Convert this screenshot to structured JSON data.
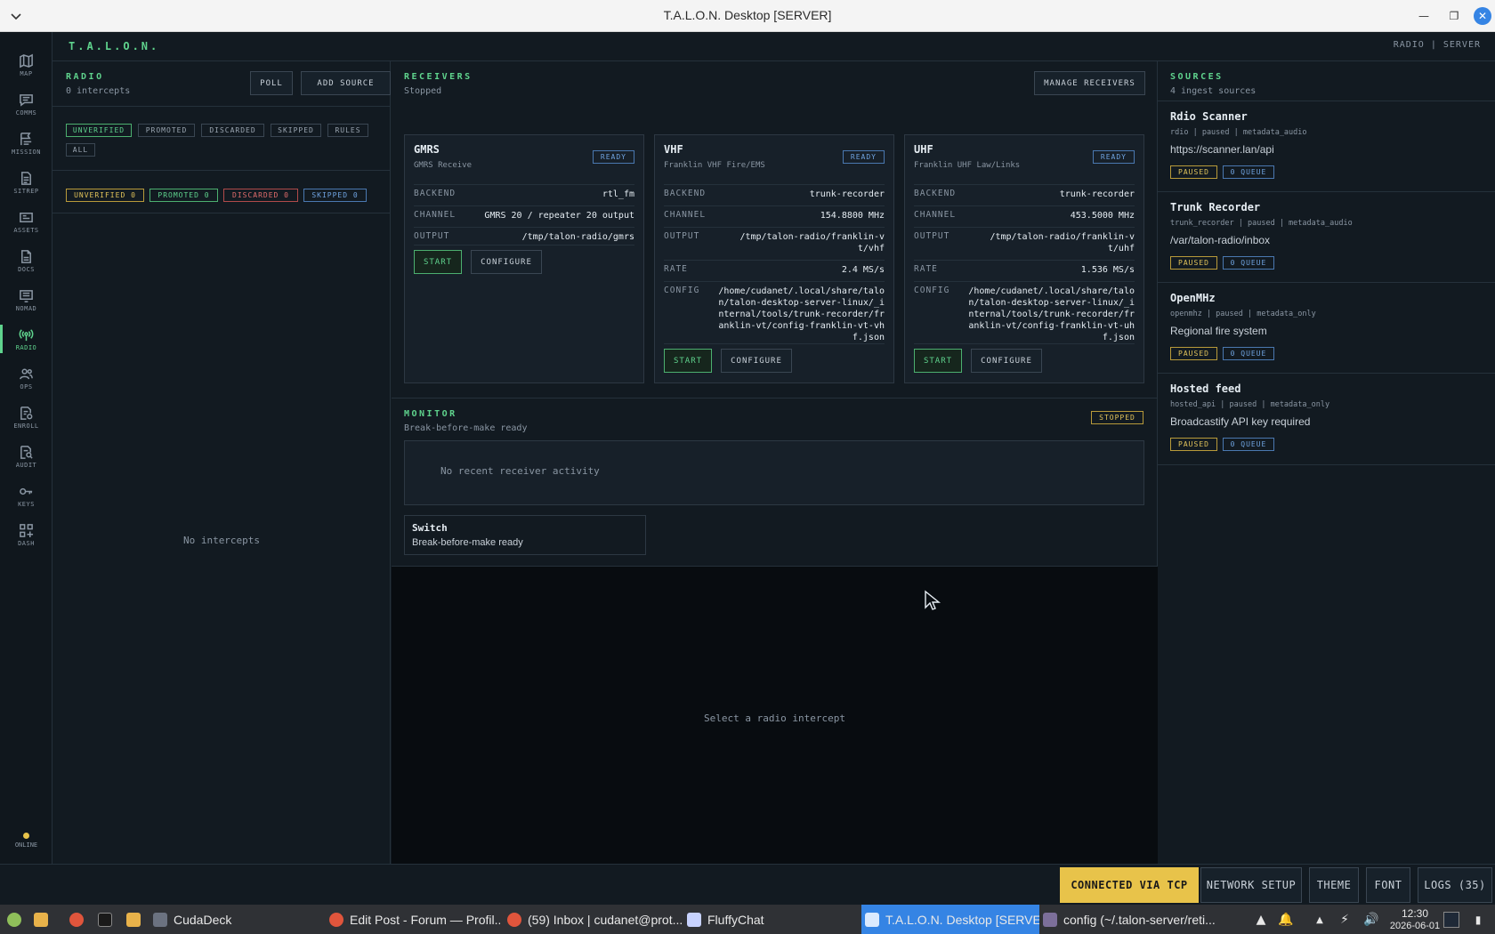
{
  "window": {
    "title": "T.A.L.O.N. Desktop [SERVER]"
  },
  "nav": [
    {
      "label": "MAP",
      "icon": "map-icon"
    },
    {
      "label": "COMMS",
      "icon": "chat-icon"
    },
    {
      "label": "MISSION",
      "icon": "mission-icon"
    },
    {
      "label": "SITREP",
      "icon": "document-icon"
    },
    {
      "label": "ASSETS",
      "icon": "assets-icon"
    },
    {
      "label": "DOCS",
      "icon": "docs-icon"
    },
    {
      "label": "NOMAD",
      "icon": "nomad-icon"
    },
    {
      "label": "RADIO",
      "icon": "radio-icon"
    },
    {
      "label": "OPS",
      "icon": "users-icon"
    },
    {
      "label": "ENROLL",
      "icon": "enroll-icon"
    },
    {
      "label": "AUDIT",
      "icon": "audit-icon"
    },
    {
      "label": "KEYS",
      "icon": "key-icon"
    },
    {
      "label": "DASH",
      "icon": "dashboard-icon"
    }
  ],
  "status_online": "ONLINE",
  "header": {
    "brand": "T.A.L.O.N.",
    "context": "RADIO | SERVER"
  },
  "radio": {
    "title": "RADIO",
    "subtitle": "0 intercepts",
    "poll_label": "POLL",
    "add_source_label": "ADD SOURCE",
    "filters": [
      "UNVERIFIED",
      "PROMOTED",
      "DISCARDED",
      "SKIPPED",
      "RULES",
      "ALL"
    ],
    "counts": [
      "UNVERIFIED 0",
      "PROMOTED 0",
      "DISCARDED 0",
      "SKIPPED 0"
    ],
    "empty": "No intercepts"
  },
  "receivers": {
    "title": "RECEIVERS",
    "status": "Stopped",
    "manage_label": "MANAGE RECEIVERS",
    "cards": [
      {
        "name": "GMRS",
        "desc": "GMRS Receive",
        "badge": "READY",
        "backend_k": "BACKEND",
        "backend": "rtl_fm",
        "channel_k": "CHANNEL",
        "channel": "GMRS 20 / repeater 20 output",
        "output_k": "OUTPUT",
        "output": "/tmp/talon-radio/gmrs",
        "start": "START",
        "configure": "CONFIGURE"
      },
      {
        "name": "VHF",
        "desc": "Franklin VHF Fire/EMS",
        "badge": "READY",
        "backend_k": "BACKEND",
        "backend": "trunk-recorder",
        "channel_k": "CHANNEL",
        "channel": "154.8800 MHz",
        "output_k": "OUTPUT",
        "output": "/tmp/talon-radio/franklin-vt/vhf",
        "rate_k": "RATE",
        "rate": "2.4 MS/s",
        "config_k": "CONFIG",
        "config": "/home/cudanet/.local/share/talon/talon-desktop-server-linux/_internal/tools/trunk-recorder/franklin-vt/config-franklin-vt-vhf.json",
        "start": "START",
        "configure": "CONFIGURE"
      },
      {
        "name": "UHF",
        "desc": "Franklin UHF Law/Links",
        "badge": "READY",
        "backend_k": "BACKEND",
        "backend": "trunk-recorder",
        "channel_k": "CHANNEL",
        "channel": "453.5000 MHz",
        "output_k": "OUTPUT",
        "output": "/tmp/talon-radio/franklin-vt/uhf",
        "rate_k": "RATE",
        "rate": "1.536 MS/s",
        "config_k": "CONFIG",
        "config": "/home/cudanet/.local/share/talon/talon-desktop-server-linux/_internal/tools/trunk-recorder/franklin-vt/config-franklin-vt-uhf.json",
        "start": "START",
        "configure": "CONFIGURE"
      }
    ]
  },
  "monitor": {
    "title": "MONITOR",
    "subtitle": "Break-before-make ready",
    "badge": "STOPPED",
    "activity": "No recent receiver activity",
    "switch_title": "Switch",
    "switch_sub": "Break-before-make ready"
  },
  "detail": {
    "empty": "Select a radio intercept"
  },
  "sources": {
    "title": "SOURCES",
    "subtitle": "4 ingest sources",
    "items": [
      {
        "name": "Rdio Scanner",
        "meta": "rdio | paused | metadata_audio",
        "url": "https://scanner.lan/api",
        "state": "PAUSED",
        "queue": "0 QUEUE"
      },
      {
        "name": "Trunk Recorder",
        "meta": "trunk_recorder | paused | metadata_audio",
        "url": "/var/talon-radio/inbox",
        "state": "PAUSED",
        "queue": "0 QUEUE"
      },
      {
        "name": "OpenMHz",
        "meta": "openmhz | paused | metadata_only",
        "url": "Regional fire system",
        "state": "PAUSED",
        "queue": "0 QUEUE"
      },
      {
        "name": "Hosted feed",
        "meta": "hosted_api | paused | metadata_only",
        "url": "Broadcastify API key required",
        "state": "PAUSED",
        "queue": "0 QUEUE"
      }
    ]
  },
  "statusbar": {
    "connected": "CONNECTED VIA TCP",
    "network": "NETWORK SETUP",
    "theme": "THEME",
    "font": "FONT",
    "logs": "LOGS (35)"
  },
  "taskbar": {
    "items": [
      "CudaDeck",
      "Edit Post - Forum — Profil...",
      "(59) Inbox | cudanet@prot...",
      "FluffyChat",
      "T.A.L.O.N. Desktop [SERVER]",
      "config (~/.talon-server/reti..."
    ],
    "time": "12:30",
    "date": "2026-06-01"
  },
  "colors": {
    "accent": "#5fd38d",
    "warning": "#e0c25a",
    "danger": "#e06c6c",
    "info": "#6fa3e0",
    "connected_bg": "#e8c34a",
    "taskbar_active": "#3584e4"
  }
}
